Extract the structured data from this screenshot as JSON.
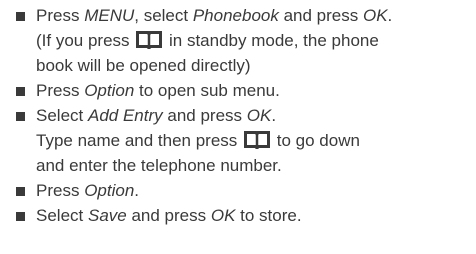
{
  "steps": [
    {
      "lines": [
        {
          "t1": "Press ",
          "e1": "MENU",
          "t2": ", select ",
          "e2": "Phonebook",
          "t3": " and press ",
          "e3": "OK",
          "t4": "."
        },
        {
          "t1": "(If you press ",
          "t2": " in standby mode, the phone"
        },
        {
          "t1": "book will be opened directly)"
        }
      ]
    },
    {
      "lines": [
        {
          "t1": "Press ",
          "e1": "Option",
          "t2": " to open sub menu."
        }
      ]
    },
    {
      "lines": [
        {
          "t1": "Select ",
          "e1": "Add Entry",
          "t2": " and press ",
          "e2": "OK",
          "t3": "."
        },
        {
          "t1": "Type name and then press ",
          "t2": " to go down"
        },
        {
          "t1": "and enter the telephone number."
        }
      ]
    },
    {
      "lines": [
        {
          "t1": "Press ",
          "e1": "Option",
          "t2": "."
        }
      ]
    },
    {
      "lines": [
        {
          "t1": "Select ",
          "e1": "Save",
          "t2": " and press ",
          "e2": "OK",
          "t3": " to store."
        }
      ]
    }
  ],
  "icons": {
    "phonebook_key": "book-icon"
  }
}
